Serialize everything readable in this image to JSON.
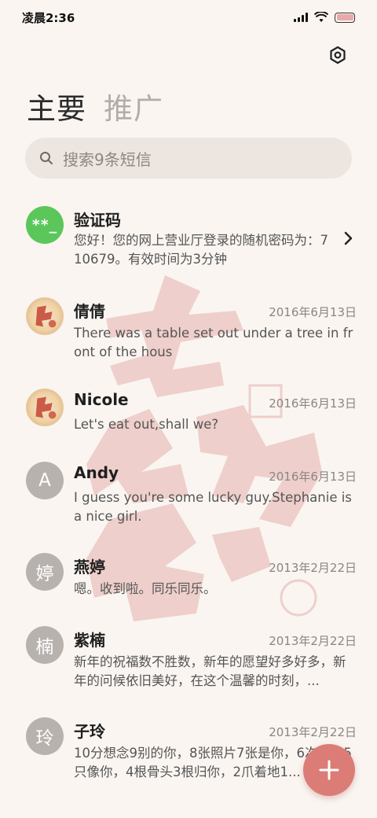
{
  "status_bar": {
    "time": "凌晨2:36"
  },
  "tabs": [
    {
      "label": "主要",
      "active": true
    },
    {
      "label": "推广",
      "active": false
    }
  ],
  "search": {
    "placeholder": "搜索9条短信"
  },
  "conversations": [
    {
      "name": "验证码",
      "avatar": "**_",
      "avatar_type": "green",
      "date": "",
      "preview": "您好！您的网上营业厅登录的随机密码为：710679。有效时间为3分钟",
      "has_chevron": true
    },
    {
      "name": "倩倩",
      "avatar": "",
      "avatar_type": "image",
      "date": "2016年6月13日",
      "preview": "There was a table set out under a tree in front of the hous"
    },
    {
      "name": "Nicole",
      "avatar": "",
      "avatar_type": "image",
      "date": "2016年6月13日",
      "preview": "Let's eat out,shall we?"
    },
    {
      "name": "Andy",
      "avatar": "A",
      "avatar_type": "letter",
      "date": "2016年6月13日",
      "preview": "I guess you're some lucky guy.Stephanie is a nice girl."
    },
    {
      "name": "燕婷",
      "avatar": "婷",
      "avatar_type": "letter",
      "date": "2013年2月22日",
      "preview": "嗯。收到啦。同乐同乐。"
    },
    {
      "name": "紫楠",
      "avatar": "楠",
      "avatar_type": "letter",
      "date": "2013年2月22日",
      "preview": "新年的祝福数不胜数，新年的愿望好多好多，新年的问候依旧美好，在这个温馨的时刻，..."
    },
    {
      "name": "子玲",
      "avatar": "玲",
      "avatar_type": "letter",
      "date": "2013年2月22日",
      "preview": "10分想念9别的你，8张照片7张是你，6次梦中5只像你，4根骨头3根归你，2爪着地1..."
    }
  ],
  "colors": {
    "accent": "#db7d76",
    "background": "#faf5f1",
    "green_avatar": "#5bc65a"
  },
  "icons": [
    "settings-icon",
    "search-icon",
    "chevron-right-icon",
    "plus-icon"
  ]
}
